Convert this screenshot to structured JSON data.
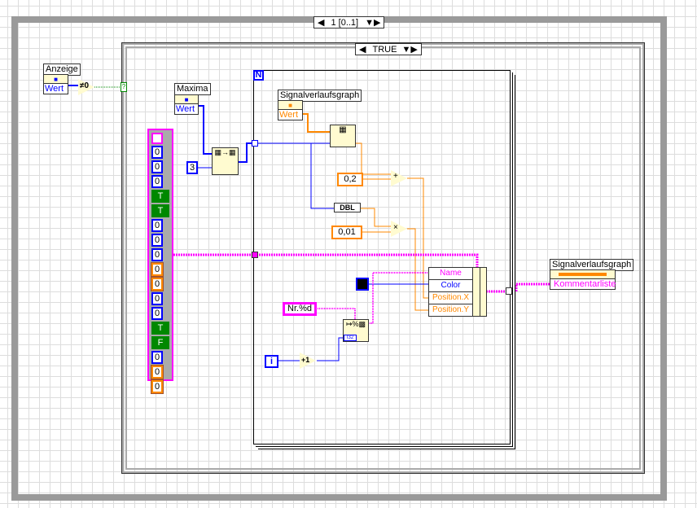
{
  "sequence": {
    "selector": "1 [0..1]"
  },
  "case": {
    "selector": "TRUE"
  },
  "anzeige": {
    "label": "Anzeige",
    "prop": "Wert"
  },
  "not_equal_zero": "≠0",
  "maxima": {
    "label": "Maxima",
    "prop": "Wert"
  },
  "const_3": "3",
  "for_loop": {
    "count": "N",
    "iteration": "i"
  },
  "signal_local": {
    "label": "Signalverlaufsgraph",
    "prop": "Wert"
  },
  "const_02": "0,2",
  "dbl": "DBL",
  "const_001": "0,01",
  "add": "+",
  "multiply": "×",
  "format_const": "Nr.%d",
  "increment": "+1",
  "format_type": "I32",
  "bundle": {
    "fields": [
      "Name",
      "Color",
      "Position.X",
      "Position.Y"
    ]
  },
  "output": {
    "label": "Signalverlaufsgraph",
    "prop": "Kommentarliste"
  },
  "cluster_array": [
    "0",
    "0",
    "0",
    "T",
    "T",
    "0",
    "0",
    "0",
    "0",
    "0",
    "0",
    "0",
    "T",
    "F",
    "0",
    "0",
    "0"
  ],
  "colors": {
    "int": "#0000ff",
    "dbl": "#ff7f00",
    "string": "#ff00ff",
    "bool": "#008000",
    "cluster": "#a0522d"
  }
}
